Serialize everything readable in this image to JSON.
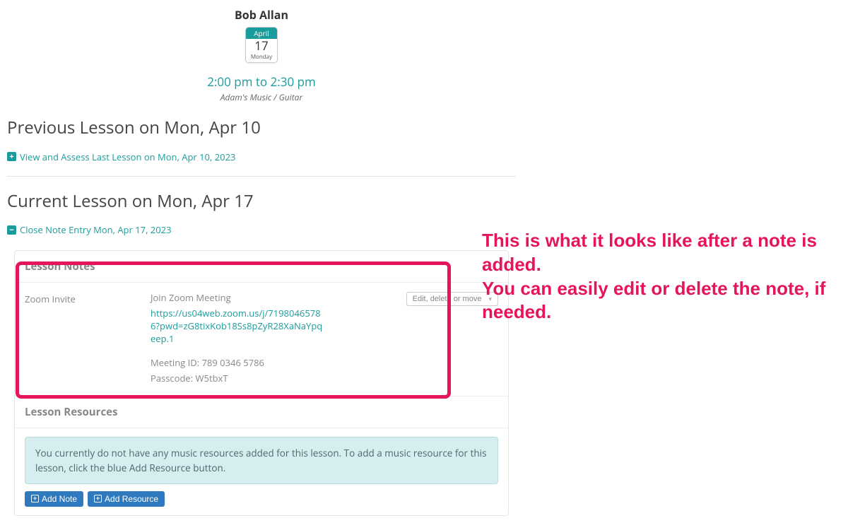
{
  "header": {
    "student_name": "Bob Allan",
    "calendar": {
      "month": "April",
      "day": "17",
      "weekday": "Monday"
    },
    "time_range": "2:00 pm to 2:30 pm",
    "location": "Adam's Music / Guitar"
  },
  "previous": {
    "title": "Previous Lesson on Mon, Apr 10",
    "link_text": "View and Assess Last Lesson on Mon, Apr 10, 2023"
  },
  "current": {
    "title": "Current Lesson on Mon, Apr 17",
    "close_link": "Close Note Entry Mon, Apr 17, 2023"
  },
  "notes_card": {
    "heading": "Lesson Notes",
    "note": {
      "label": "Zoom Invite",
      "line1": "Join Zoom Meeting",
      "link_text": "https://us04web.zoom.us/j/71980465786?pwd=zG8tixKob18Ss8pZyR28XaNaYpqeep.1",
      "meeting_id": "Meeting ID: 789 0346 5786",
      "passcode": "Passcode: W5tbxT"
    },
    "dropdown_label": "Edit, delete or move"
  },
  "resources_card": {
    "heading": "Lesson Resources",
    "empty_message": "You currently do not have any music resources added for this lesson. To add a music resource for this lesson, click the blue Add Resource button."
  },
  "buttons": {
    "add_note": "Add Note",
    "add_resource": "Add Resource"
  },
  "annotation": {
    "line1": "This is what it looks like after a note is added.",
    "line2": "You can easily edit or delete the note, if needed."
  }
}
